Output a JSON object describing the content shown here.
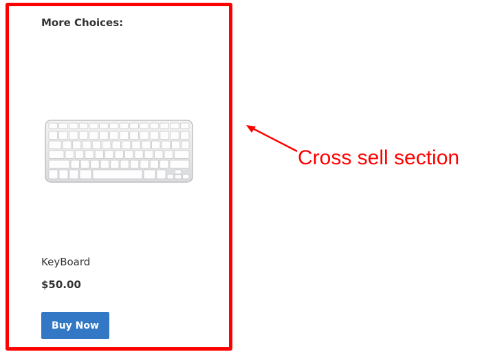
{
  "cross_sell": {
    "heading": "More Choices:",
    "product": {
      "name": "KeyBoard",
      "price": "$50.00",
      "buy_label": "Buy Now",
      "image_icon": "keyboard-image"
    }
  },
  "annotation": {
    "label": "Cross sell section",
    "color": "#ff0000"
  },
  "colors": {
    "button": "#3278c4",
    "highlight": "#ff0000",
    "text": "#333333"
  }
}
